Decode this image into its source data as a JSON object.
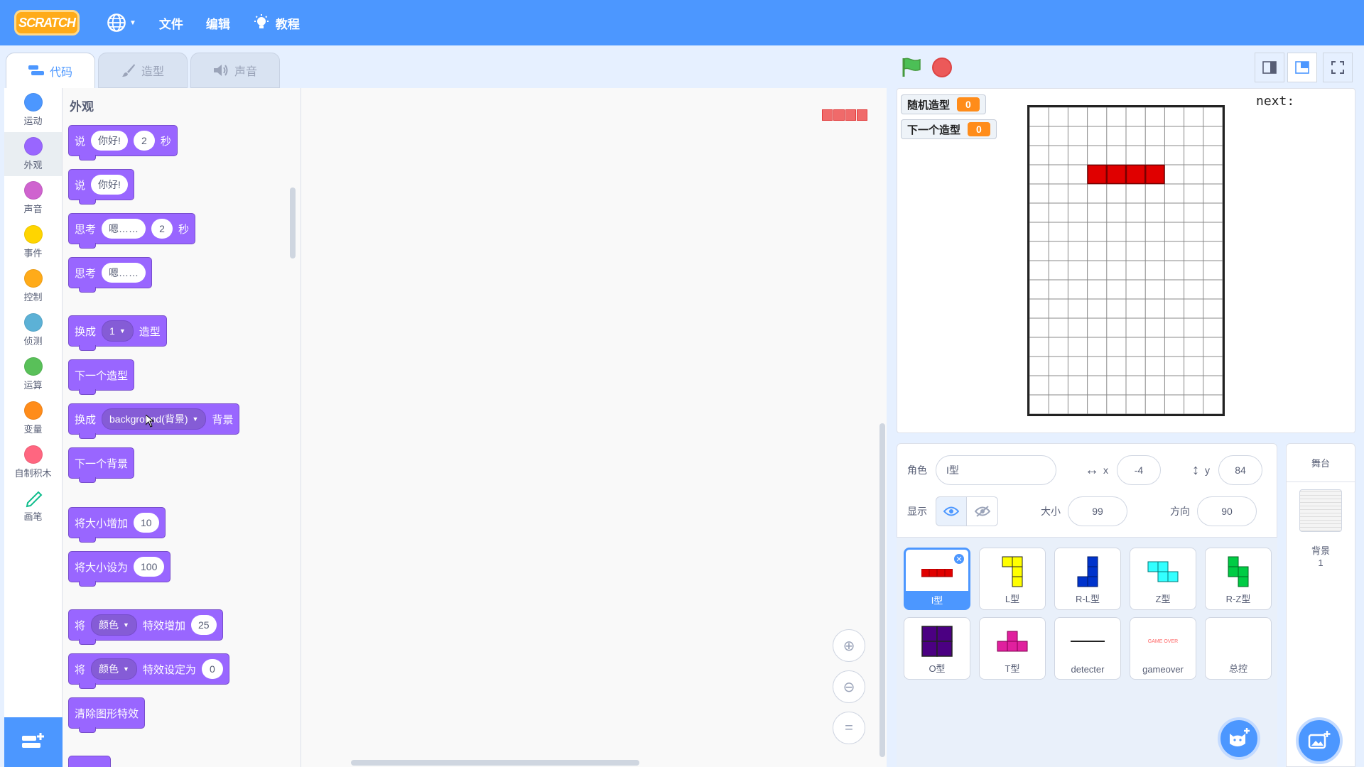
{
  "menubar": {
    "logo": "SCRATCH",
    "file": "文件",
    "edit": "编辑",
    "tutorials": "教程"
  },
  "tabs": [
    {
      "label": "代码",
      "icon": "code-icon"
    },
    {
      "label": "造型",
      "icon": "brush-icon"
    },
    {
      "label": "声音",
      "icon": "speaker-icon"
    }
  ],
  "categories": [
    {
      "label": "运动",
      "color": "#4c97ff"
    },
    {
      "label": "外观",
      "color": "#9966ff"
    },
    {
      "label": "声音",
      "color": "#cf63cf"
    },
    {
      "label": "事件",
      "color": "#ffd500"
    },
    {
      "label": "控制",
      "color": "#ffab19"
    },
    {
      "label": "侦测",
      "color": "#5cb1d6"
    },
    {
      "label": "运算",
      "color": "#59c059"
    },
    {
      "label": "变量",
      "color": "#ff8c1a"
    },
    {
      "label": "自制积木",
      "color": "#ff6680"
    },
    {
      "label": "画笔",
      "color": "#0fbd8c"
    }
  ],
  "palette": {
    "title": "外观",
    "say_secs": {
      "say": "说",
      "text": "你好!",
      "secs": "2",
      "unit": "秒"
    },
    "say": {
      "say": "说",
      "text": "你好!"
    },
    "think_secs": {
      "think": "思考",
      "text": "嗯……",
      "secs": "2",
      "unit": "秒"
    },
    "think": {
      "think": "思考",
      "text": "嗯……"
    },
    "switch_costume": {
      "pre": "换成",
      "value": "1",
      "post": "造型"
    },
    "next_costume": "下一个造型",
    "switch_backdrop": {
      "pre": "换成",
      "value": "background(背景)",
      "post": "背景"
    },
    "next_backdrop": "下一个背景",
    "change_size": {
      "label": "将大小增加",
      "value": "10"
    },
    "set_size": {
      "label": "将大小设为",
      "value": "100"
    },
    "change_effect": {
      "pre": "将",
      "effect": "颜色",
      "post": "特效增加",
      "value": "25"
    },
    "set_effect": {
      "pre": "将",
      "effect": "颜色",
      "post": "特效设定为",
      "value": "0"
    },
    "clear_effects": "清除图形特效"
  },
  "stage": {
    "monitors": [
      {
        "label": "随机造型",
        "value": "0"
      },
      {
        "label": "下一个造型",
        "value": "0"
      }
    ],
    "next_text": "next:"
  },
  "sprite_info": {
    "sprite_label": "角色",
    "sprite_name": "I型",
    "x_label": "x",
    "x_value": "-4",
    "y_label": "y",
    "y_value": "84",
    "show_label": "显示",
    "size_label": "大小",
    "size_value": "99",
    "direction_label": "方向",
    "direction_value": "90"
  },
  "sprites": [
    {
      "name": "I型",
      "color": "#e00000"
    },
    {
      "name": "L型",
      "color": "#ffff00"
    },
    {
      "name": "R-L型",
      "color": "#0033cc"
    },
    {
      "name": "Z型",
      "color": "#33ffff"
    },
    {
      "name": "R-Z型",
      "color": "#00cc44"
    },
    {
      "name": "O型",
      "color": "#4b0082"
    },
    {
      "name": "T型",
      "color": "#e0209e"
    },
    {
      "name": "detecter",
      "color": "#222222"
    },
    {
      "name": "gameover",
      "color": "#ff6666",
      "thumb_text": "GAME OVER"
    },
    {
      "name": "总控",
      "color": "#ffffff"
    }
  ],
  "stage_pane": {
    "title": "舞台",
    "backdrop_label": "背景",
    "backdrop_count": "1"
  }
}
